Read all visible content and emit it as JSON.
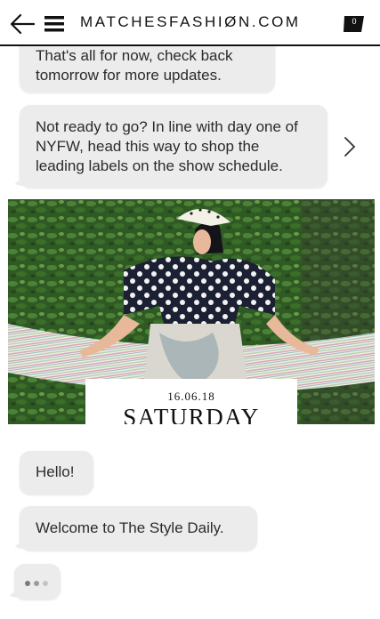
{
  "header": {
    "brand": "MATCHESFASHIØN.COM",
    "back_icon": "arrow-left-icon",
    "menu_icon": "hamburger-menu-icon",
    "bag_icon": "shopping-bag-icon",
    "bag_count": "0"
  },
  "messages": [
    {
      "text": "That's all for now, check back tomorrow for more updates."
    },
    {
      "text": "Not ready to go? In line with day one of NYFW, head this way to shop the leading labels on the show schedule."
    },
    {
      "text": "Hello!"
    },
    {
      "text": "Welcome to The Style Daily."
    }
  ],
  "card": {
    "date": "16.06.18",
    "day": "SATURDAY"
  },
  "colors": {
    "bubble": "#ececec",
    "text": "#2b2b2b",
    "header_border": "#111111",
    "typing_dot_active": "#7a7a7a",
    "typing_dot_inactive": "#c4c4c4"
  }
}
